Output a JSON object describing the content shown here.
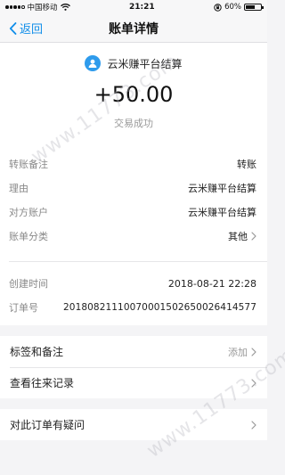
{
  "status_bar": {
    "carrier": "中国移动",
    "time": "21:21",
    "battery": "60%",
    "battery_level": 0.6
  },
  "nav": {
    "back_label": "返回",
    "title": "账单详情"
  },
  "header": {
    "merchant": "云米赚平台结算",
    "amount": "+50.00",
    "status": "交易成功"
  },
  "details": {
    "rows": [
      {
        "label": "转账备注",
        "value": "转账"
      },
      {
        "label": "理由",
        "value": "云米赚平台结算"
      },
      {
        "label": "对方账户",
        "value": "云米赚平台结算"
      },
      {
        "label": "账单分类",
        "value": "其他"
      },
      {
        "label": "创建时间",
        "value": "2018-08-21 22:28"
      },
      {
        "label": "订单号",
        "value": "20180821110070001502650026414577"
      }
    ]
  },
  "menu": {
    "tags_label": "标签和备注",
    "tags_action": "添加",
    "history_label": "查看往来记录",
    "question_label": "对此订单有疑问"
  },
  "watermark": {
    "text": "www.11773.com"
  }
}
